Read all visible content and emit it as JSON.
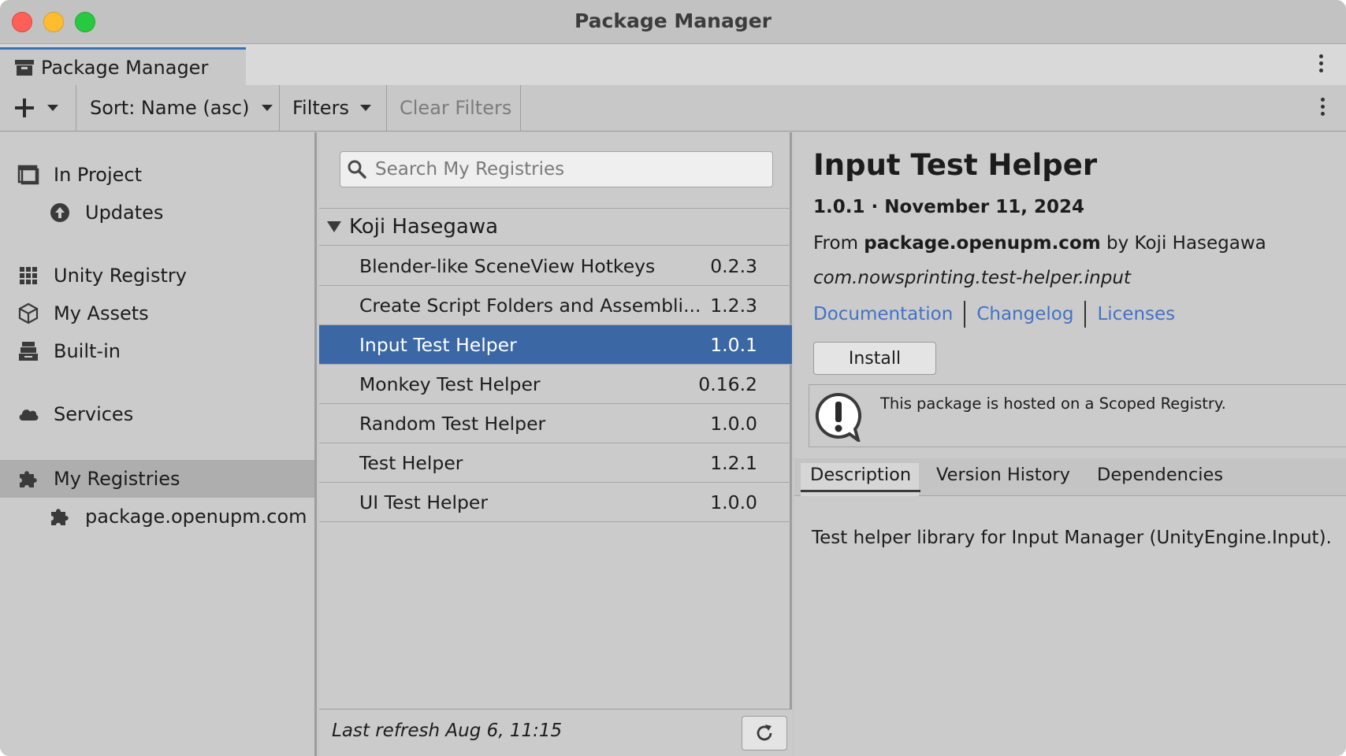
{
  "window": {
    "title": "Package Manager"
  },
  "tab": {
    "label": "Package Manager"
  },
  "toolbar": {
    "add_label": "+",
    "sort_label": "Sort: Name (asc)",
    "filters_label": "Filters",
    "clear_filters_label": "Clear Filters"
  },
  "sidebar": {
    "items": [
      {
        "label": "In Project",
        "icon": "in-project-icon"
      },
      {
        "label": "Updates",
        "icon": "updates-icon"
      },
      {
        "label": "Unity Registry",
        "icon": "grid-icon"
      },
      {
        "label": "My Assets",
        "icon": "cube-icon"
      },
      {
        "label": "Built-in",
        "icon": "built-in-icon"
      },
      {
        "label": "Services",
        "icon": "cloud-icon"
      },
      {
        "label": "My Registries",
        "icon": "puzzle-icon",
        "selected": true
      },
      {
        "label": "package.openupm.com",
        "icon": "puzzle-icon"
      }
    ]
  },
  "list": {
    "search_placeholder": "Search My Registries",
    "group_name": "Koji Hasegawa",
    "packages": [
      {
        "name": "Blender-like SceneView Hotkeys",
        "version": "0.2.3"
      },
      {
        "name": "Create Script Folders and Assembli...",
        "version": "1.2.3"
      },
      {
        "name": "Input Test Helper",
        "version": "1.0.1",
        "selected": true
      },
      {
        "name": "Monkey Test Helper",
        "version": "0.16.2"
      },
      {
        "name": "Random Test Helper",
        "version": "1.0.0"
      },
      {
        "name": "Test Helper",
        "version": "1.2.1"
      },
      {
        "name": "UI Test Helper",
        "version": "1.0.0"
      }
    ],
    "last_refresh": "Last refresh Aug 6, 11:15"
  },
  "details": {
    "title": "Input Test Helper",
    "version_date": "1.0.1 · November 11, 2024",
    "from_prefix": "From",
    "registry": "package.openupm.com",
    "by_text": "by Koji Hasegawa",
    "package_id": "com.nowsprinting.test-helper.input",
    "links": [
      "Documentation",
      "Changelog",
      "Licenses"
    ],
    "install_label": "Install",
    "notice": "This package is hosted on a Scoped Registry.",
    "tabs": [
      "Description",
      "Version History",
      "Dependencies"
    ],
    "description": "Test helper library for Input Manager (UnityEngine.Input)."
  },
  "colors": {
    "selection": "#3b67a5",
    "link": "#3f73c9",
    "tab_accent": "#3a72b0"
  }
}
